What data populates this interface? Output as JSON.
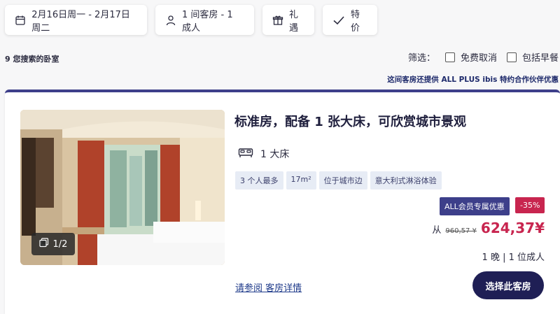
{
  "filters_bar": {
    "dates_label": "2月16日周一 - 2月17日周二",
    "guests_label": "1 间客房 - 1 成人",
    "perks_label": "礼遇",
    "price_label": "特价"
  },
  "results": {
    "count_text": "9 您搜索的卧室",
    "filter_label": "筛选：",
    "filter_free_cancel": "免费取消",
    "filter_breakfast": "包括早餐",
    "partner_note": "这间客房还提供 ALL PLUS ibis 特约合作伙伴优惠"
  },
  "room": {
    "title": "标准房，配备 1 张大床，可欣赏城市景观",
    "bed": "1 大床",
    "tags": [
      "3 个人最多",
      "17m²",
      "位于城市边",
      "意大利式淋浴体验"
    ],
    "photo_counter": "1/2",
    "member_badge": "ALL会员专属优惠",
    "discount_badge": "-35%",
    "price_from": "从",
    "price_old": "960,57 ¥",
    "price_new": "624,37¥",
    "stay_info": "1 晚 | 1 位成人",
    "details_link": "请参阅 客房详情",
    "select_button": "选择此客房"
  },
  "colors": {
    "accent": "#3d3f8a",
    "sale": "#c8254f",
    "button": "#1f1f55"
  }
}
